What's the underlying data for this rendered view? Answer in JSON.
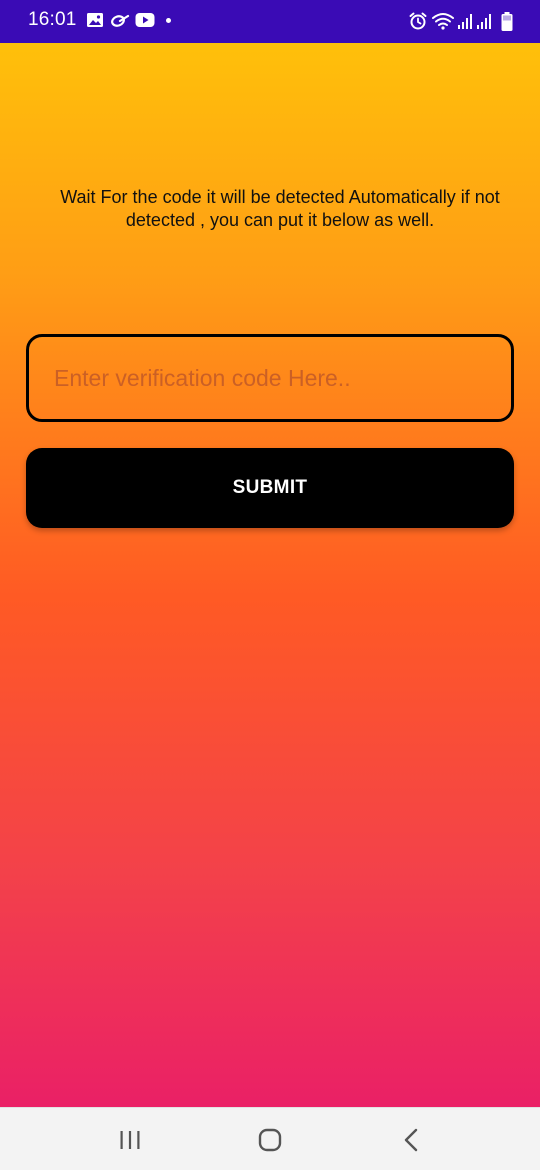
{
  "status_bar": {
    "time": "16:01",
    "background": "#3a0bb5",
    "left_icons": [
      "gallery-icon",
      "link-icon",
      "youtube-icon",
      "notification-dot-icon"
    ],
    "right_icons": [
      "alarm-icon",
      "wifi-icon",
      "signal-icon",
      "signal-icon",
      "battery-icon"
    ]
  },
  "main": {
    "instructions": "Wait For the code it will be detected Automatically if not detected , you can put it below as well.",
    "code_input": {
      "value": "",
      "placeholder": "Enter verification code Here.."
    },
    "submit_label": "SUBMIT",
    "gradient_colors": [
      "#ffc00a",
      "#ff9d15",
      "#ff5a24",
      "#f3414a",
      "#ea2066"
    ]
  },
  "nav_bar": {
    "buttons": [
      "recent-apps-icon",
      "home-icon",
      "back-icon"
    ]
  }
}
